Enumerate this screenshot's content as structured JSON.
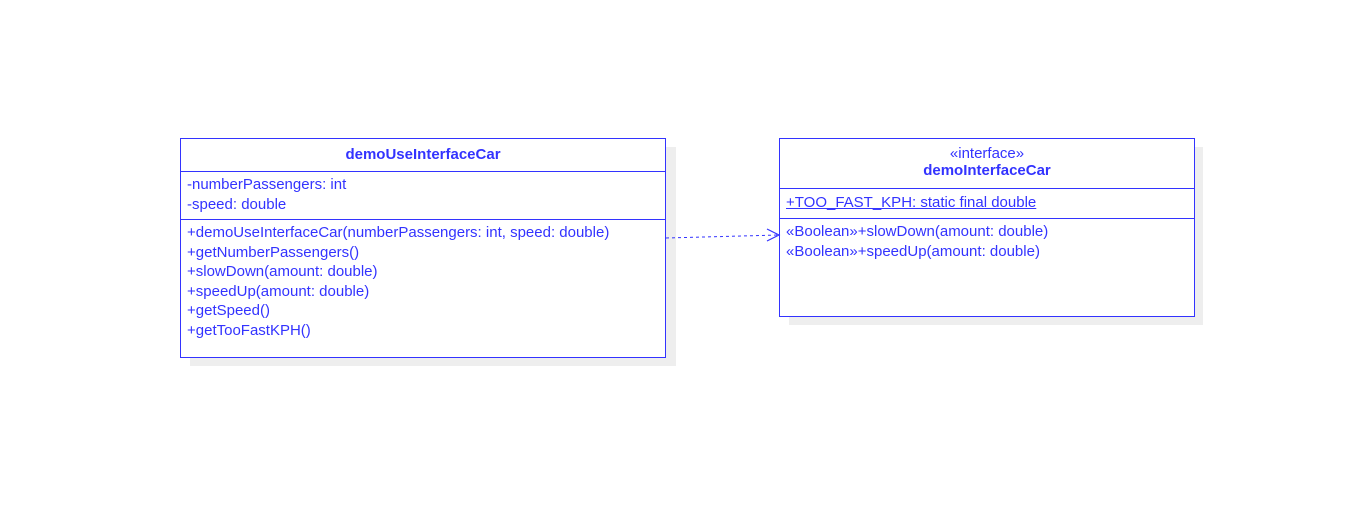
{
  "classes": {
    "use": {
      "name": "demoUseInterfaceCar",
      "attributes": [
        "-numberPassengers: int",
        "-speed: double"
      ],
      "methods": [
        "+demoUseInterfaceCar(numberPassengers: int, speed: double)",
        "+getNumberPassengers()",
        "+slowDown(amount: double)",
        "+speedUp(amount: double)",
        "+getSpeed()",
        "+getTooFastKPH()"
      ]
    },
    "iface": {
      "stereotype": "«interface»",
      "name": "demoInterfaceCar",
      "attributes": [
        "+TOO_FAST_KPH: static final double"
      ],
      "methods": [
        "«Boolean»+slowDown(amount: double)",
        "«Boolean»+speedUp(amount: double)"
      ]
    }
  },
  "relationships": [
    {
      "type": "dependency",
      "from": "demoUseInterfaceCar",
      "to": "demoInterfaceCar",
      "style": "dashed",
      "arrow": "open"
    }
  ],
  "colors": {
    "stroke": "#3333ff",
    "text": "#3333ff",
    "shadow": "#eeeeee"
  }
}
